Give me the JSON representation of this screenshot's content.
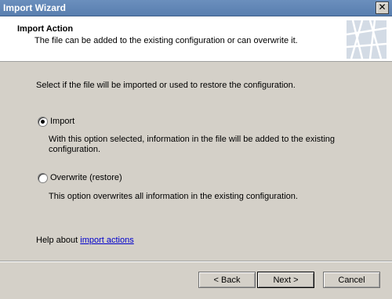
{
  "window": {
    "title": "Import Wizard",
    "close_glyph": "✕"
  },
  "header": {
    "title": "Import Action",
    "subtitle": "The file can be added to the existing configuration or can overwrite it."
  },
  "body": {
    "instruction": "Select if the file will be imported or used to restore the configuration.",
    "options": [
      {
        "label": "Import",
        "selected": true,
        "description": "With this option selected, information in the file will be added to the existing configuration."
      },
      {
        "label": "Overwrite (restore)",
        "selected": false,
        "description": "This option overwrites all information in the existing configuration."
      }
    ],
    "help_prefix": "Help about ",
    "help_link": "import actions"
  },
  "buttons": {
    "back": "< Back",
    "next": "Next >",
    "cancel": "Cancel"
  }
}
